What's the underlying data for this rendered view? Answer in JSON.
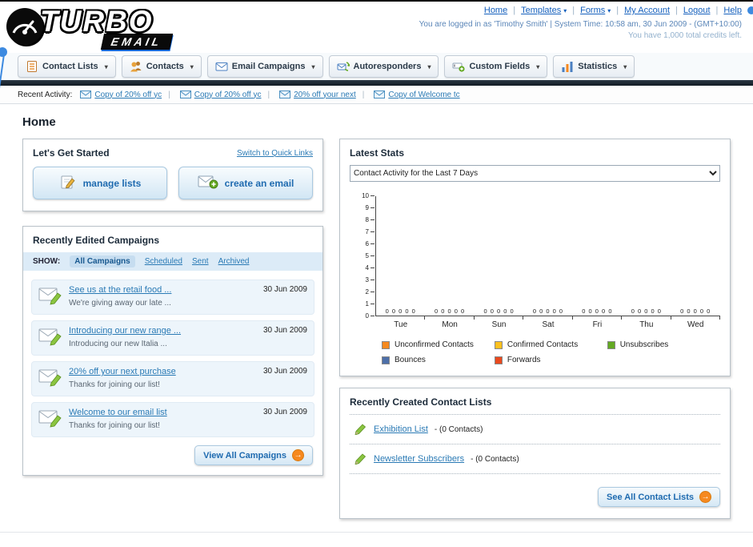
{
  "icons": {
    "dropdown_caret": "▾",
    "arrow": "→"
  },
  "logo": {
    "primary": "TURBO",
    "secondary": "EMAIL"
  },
  "header": {
    "links": [
      "Home",
      "Templates",
      "Forms",
      "My Account",
      "Logout",
      "Help"
    ],
    "login_info": "You are logged in as 'Timothy Smith' | System Time: 10:58 am, 30 Jun 2009 - (GMT+10:00)",
    "credits_info": "You have 1,000 total credits left."
  },
  "main_nav": {
    "tabs": [
      "Contact Lists",
      "Contacts",
      "Email Campaigns",
      "Autoresponders",
      "Custom Fields",
      "Statistics"
    ]
  },
  "recent_activity": {
    "label": "Recent Activity:",
    "items": [
      {
        "text": "Copy of 20% off yc"
      },
      {
        "text": "Copy of 20% off yc"
      },
      {
        "text": "20% off your next"
      },
      {
        "text": "Copy of Welcome tc"
      }
    ]
  },
  "page": {
    "title": "Home"
  },
  "get_started": {
    "title": "Let's Get Started",
    "switch_link": "Switch to Quick Links",
    "manage_lists_label": "manage lists",
    "create_email_label": "create an email"
  },
  "campaigns": {
    "title": "Recently Edited Campaigns",
    "show_label": "SHOW:",
    "filters": [
      "All Campaigns",
      "Scheduled",
      "Sent",
      "Archived"
    ],
    "items": [
      {
        "title": "See us at the retail food ...",
        "subtitle": "We're giving away our late ...",
        "date": "30 Jun 2009"
      },
      {
        "title": "Introducing our new range ...",
        "subtitle": "Introducing our new Italia ...",
        "date": "30 Jun 2009"
      },
      {
        "title": "20% off your next purchase",
        "subtitle": "Thanks for joining our list!",
        "date": "30 Jun 2009"
      },
      {
        "title": "Welcome to our email list",
        "subtitle": "Thanks for joining our list!",
        "date": "30 Jun 2009"
      }
    ],
    "view_all_label": "View All Campaigns"
  },
  "stats": {
    "title": "Latest Stats",
    "dropdown_selected": "Contact Activity for the Last 7 Days",
    "chart_data": {
      "type": "bar",
      "title": "Contact Activity for the Last 7 Days",
      "categories": [
        "Tue",
        "Mon",
        "Sun",
        "Sat",
        "Fri",
        "Thu",
        "Wed"
      ],
      "series": [
        {
          "name": "Unconfirmed Contacts",
          "color": "#f6891f",
          "values": [
            0,
            0,
            0,
            0,
            0,
            0,
            0
          ]
        },
        {
          "name": "Confirmed Contacts",
          "color": "#fcc01e",
          "values": [
            0,
            0,
            0,
            0,
            0,
            0,
            0
          ]
        },
        {
          "name": "Unsubscribes",
          "color": "#63a922",
          "values": [
            0,
            0,
            0,
            0,
            0,
            0,
            0
          ]
        },
        {
          "name": "Bounces",
          "color": "#4d6fa8",
          "values": [
            0,
            0,
            0,
            0,
            0,
            0,
            0
          ]
        },
        {
          "name": "Forwards",
          "color": "#e9491e",
          "values": [
            0,
            0,
            0,
            0,
            0,
            0,
            0
          ]
        }
      ],
      "ylim": [
        0,
        10
      ],
      "yticks": [
        0,
        1,
        2,
        3,
        4,
        5,
        6,
        7,
        8,
        9,
        10
      ],
      "grid": false,
      "legend_position": "bottom",
      "xlabel": "",
      "ylabel": ""
    }
  },
  "contact_lists": {
    "title": "Recently Created Contact Lists",
    "items": [
      {
        "name": "Exhibition List",
        "suffix": "- (0 Contacts)"
      },
      {
        "name": "Newsletter Subscribers",
        "suffix": "- (0 Contacts)"
      }
    ],
    "see_all_label": "See All Contact Lists"
  }
}
